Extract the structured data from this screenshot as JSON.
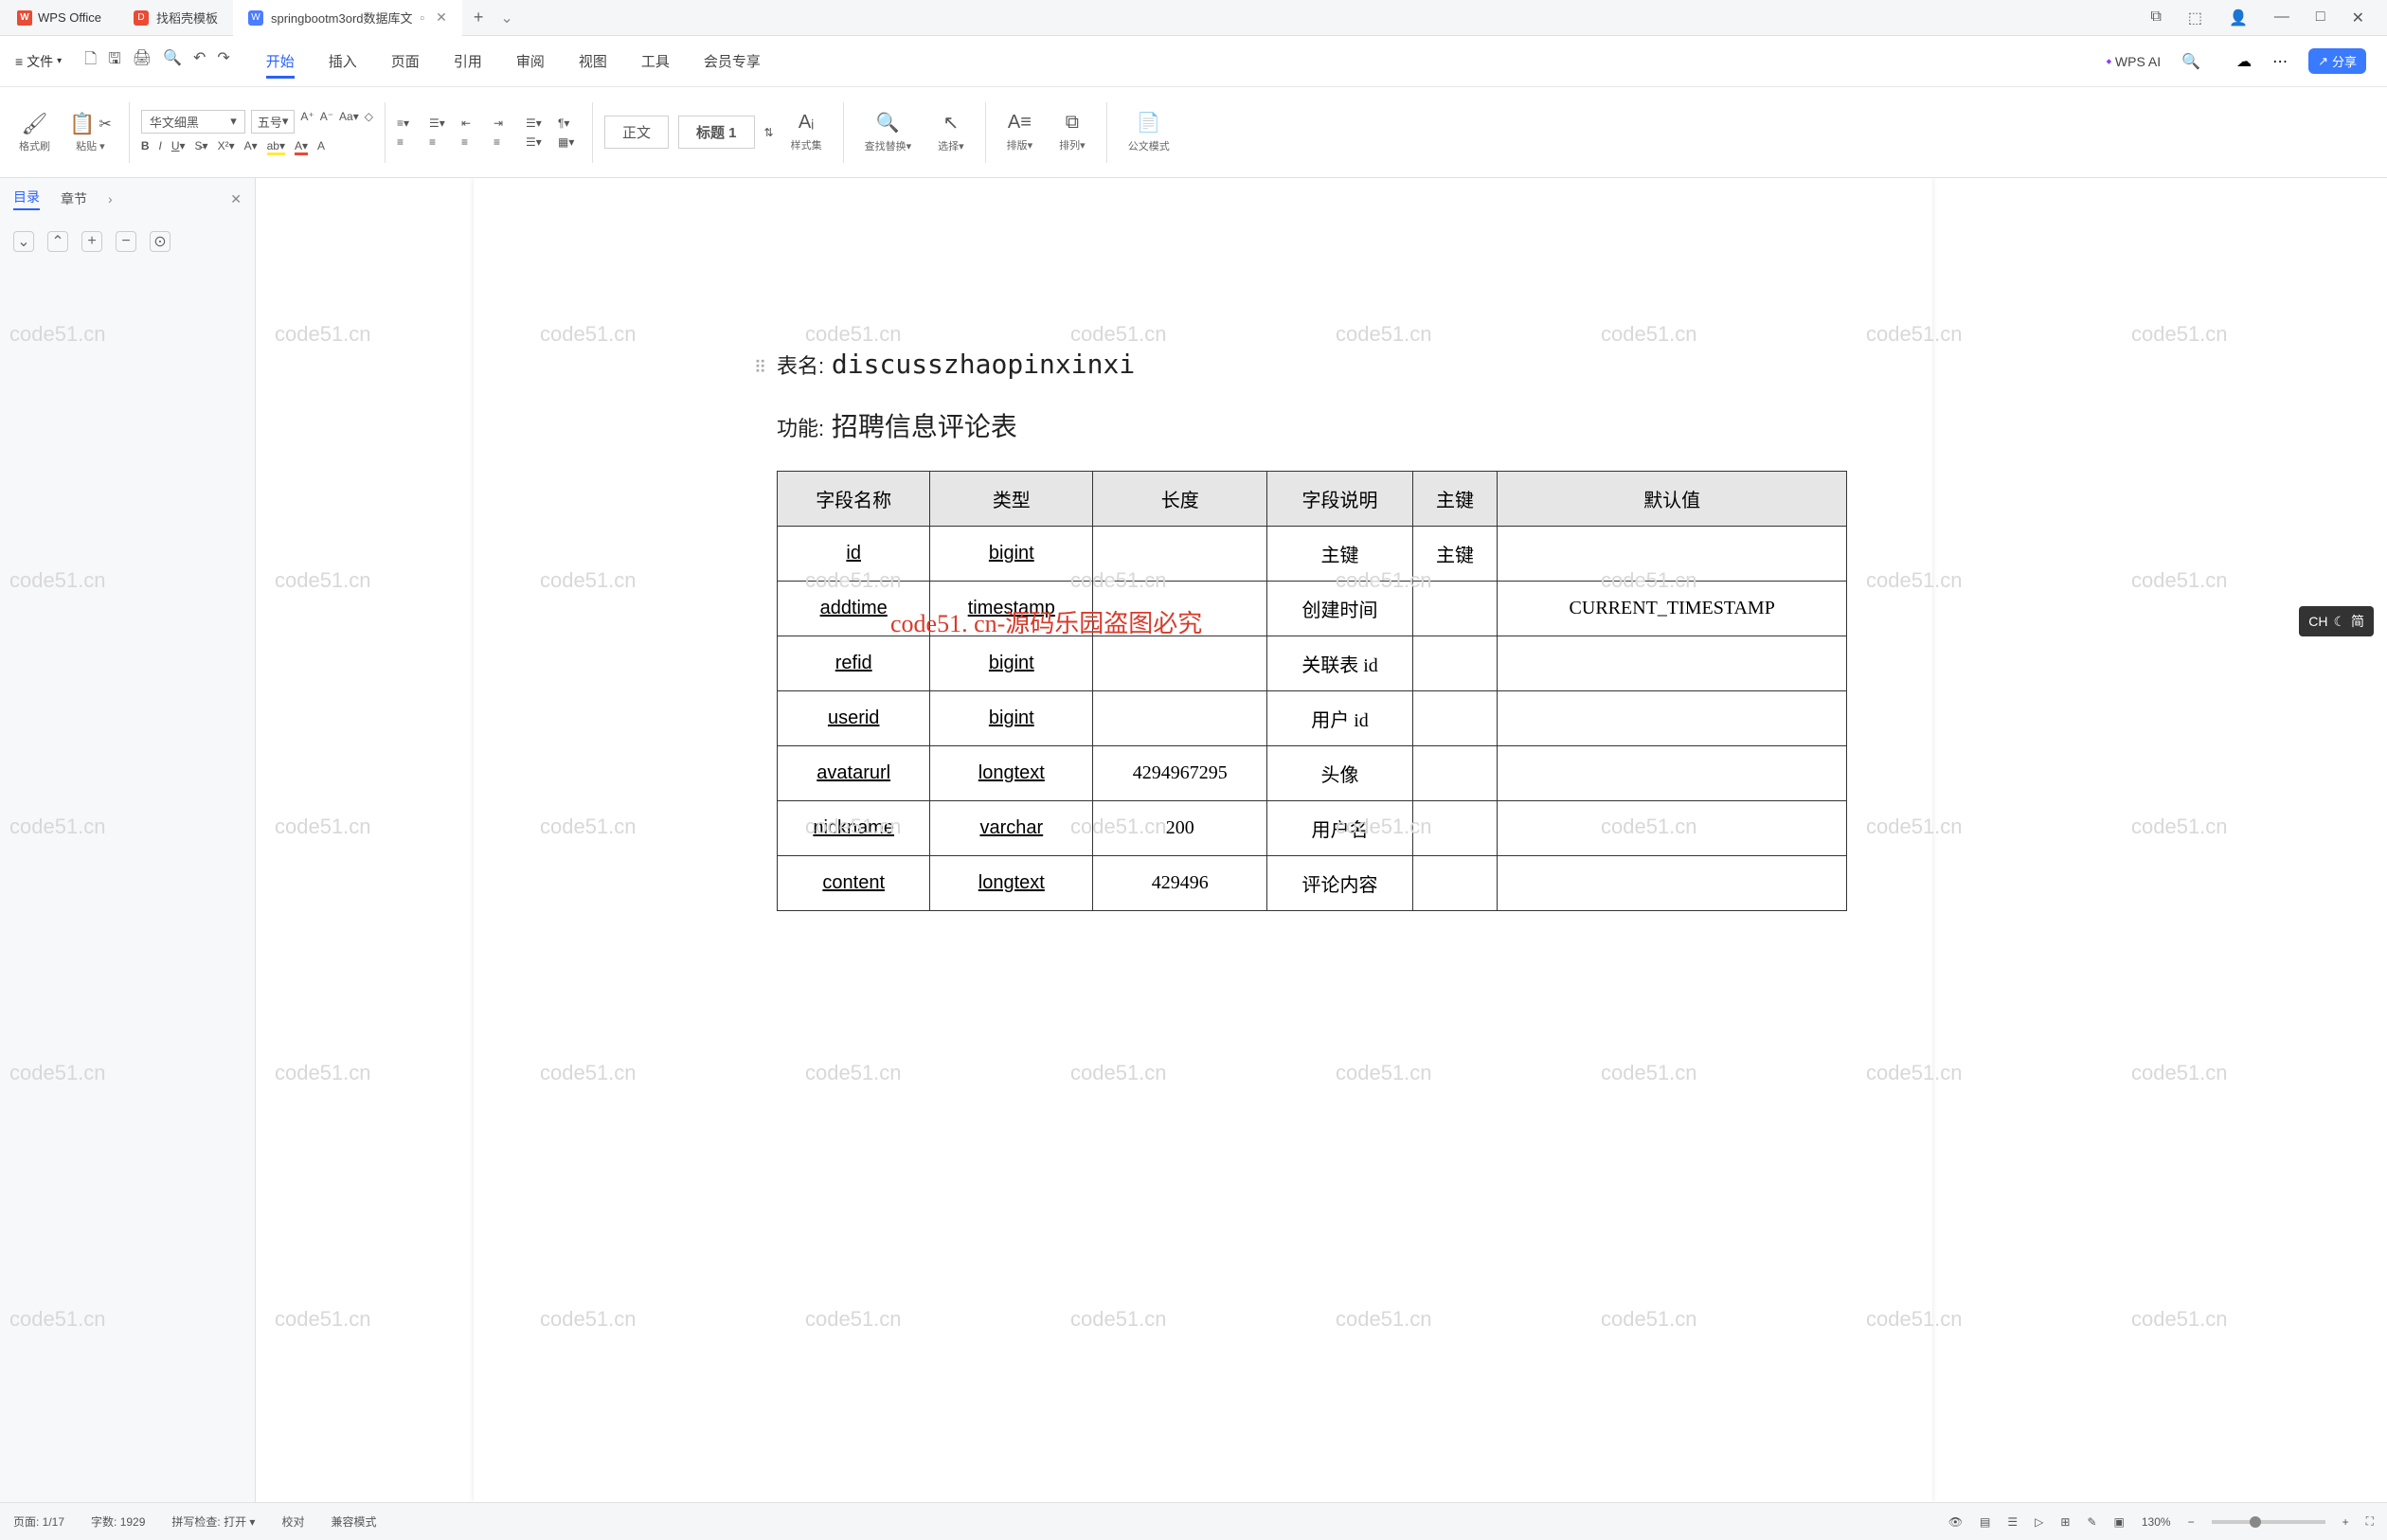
{
  "app": {
    "name": "WPS Office"
  },
  "tabs": [
    {
      "label": "找稻壳模板",
      "icon": "red"
    },
    {
      "label": "springbootm3ord数据库文",
      "icon": "blue",
      "active": true
    }
  ],
  "tab_add": "+",
  "win": {
    "min": "—",
    "max": "□",
    "close": "✕"
  },
  "menu": {
    "file": "文件",
    "quick_icons": [
      "↩",
      "↪",
      "🖨",
      "🔍"
    ],
    "tabs": [
      "开始",
      "插入",
      "页面",
      "引用",
      "审阅",
      "视图",
      "工具",
      "会员专享"
    ],
    "active_tab": "开始",
    "wps_ai": "WPS AI",
    "cloud": "☁",
    "share": "分享"
  },
  "ribbon": {
    "format_painter": "格式刷",
    "paste": "粘贴",
    "font_name": "华文细黑",
    "font_size": "五号",
    "style_normal": "正文",
    "style_heading": "标题 1",
    "style_set": "样式集",
    "find_replace": "查找替换",
    "select": "选择",
    "arrange": "排版",
    "layout": "排列",
    "doc_mode": "公文模式"
  },
  "nav": {
    "outline": "目录",
    "chapter": "章节",
    "tools": [
      "⌄",
      "⌃",
      "+",
      "−",
      "⊙"
    ]
  },
  "document": {
    "table_name_label": "表名:",
    "table_name": "discusszhaopinxinxi",
    "function_label": "功能:",
    "function_value": "招聘信息评论表",
    "red_watermark": "code51. cn-源码乐园盗图必究",
    "watermark_text": "code51.cn",
    "headers": [
      "字段名称",
      "类型",
      "长度",
      "字段说明",
      "主键",
      "默认值"
    ],
    "rows": [
      {
        "name": "id",
        "type": "bigint",
        "len": "",
        "desc": "主键",
        "pk": "主键",
        "def": ""
      },
      {
        "name": "addtime",
        "type": "timestamp",
        "len": "",
        "desc": "创建时间",
        "pk": "",
        "def": "CURRENT_TIMESTAMP"
      },
      {
        "name": "refid",
        "type": "bigint",
        "len": "",
        "desc": "关联表 id",
        "pk": "",
        "def": ""
      },
      {
        "name": "userid",
        "type": "bigint",
        "len": "",
        "desc": "用户 id",
        "pk": "",
        "def": ""
      },
      {
        "name": "avatarurl",
        "type": "longtext",
        "len": "4294967295",
        "desc": "头像",
        "pk": "",
        "def": ""
      },
      {
        "name": "nickname",
        "type": "varchar",
        "len": "200",
        "desc": "用户名",
        "pk": "",
        "def": ""
      },
      {
        "name": "content",
        "type": "longtext",
        "len": "429496",
        "desc": "评论内容",
        "pk": "",
        "def": ""
      }
    ]
  },
  "status": {
    "page": "页面: 1/17",
    "words": "字数: 1929",
    "spell": "拼写检查: 打开",
    "proof": "校对",
    "compat": "兼容模式",
    "zoom": "130%"
  },
  "ime": {
    "lang": "CH",
    "mode": "简"
  }
}
